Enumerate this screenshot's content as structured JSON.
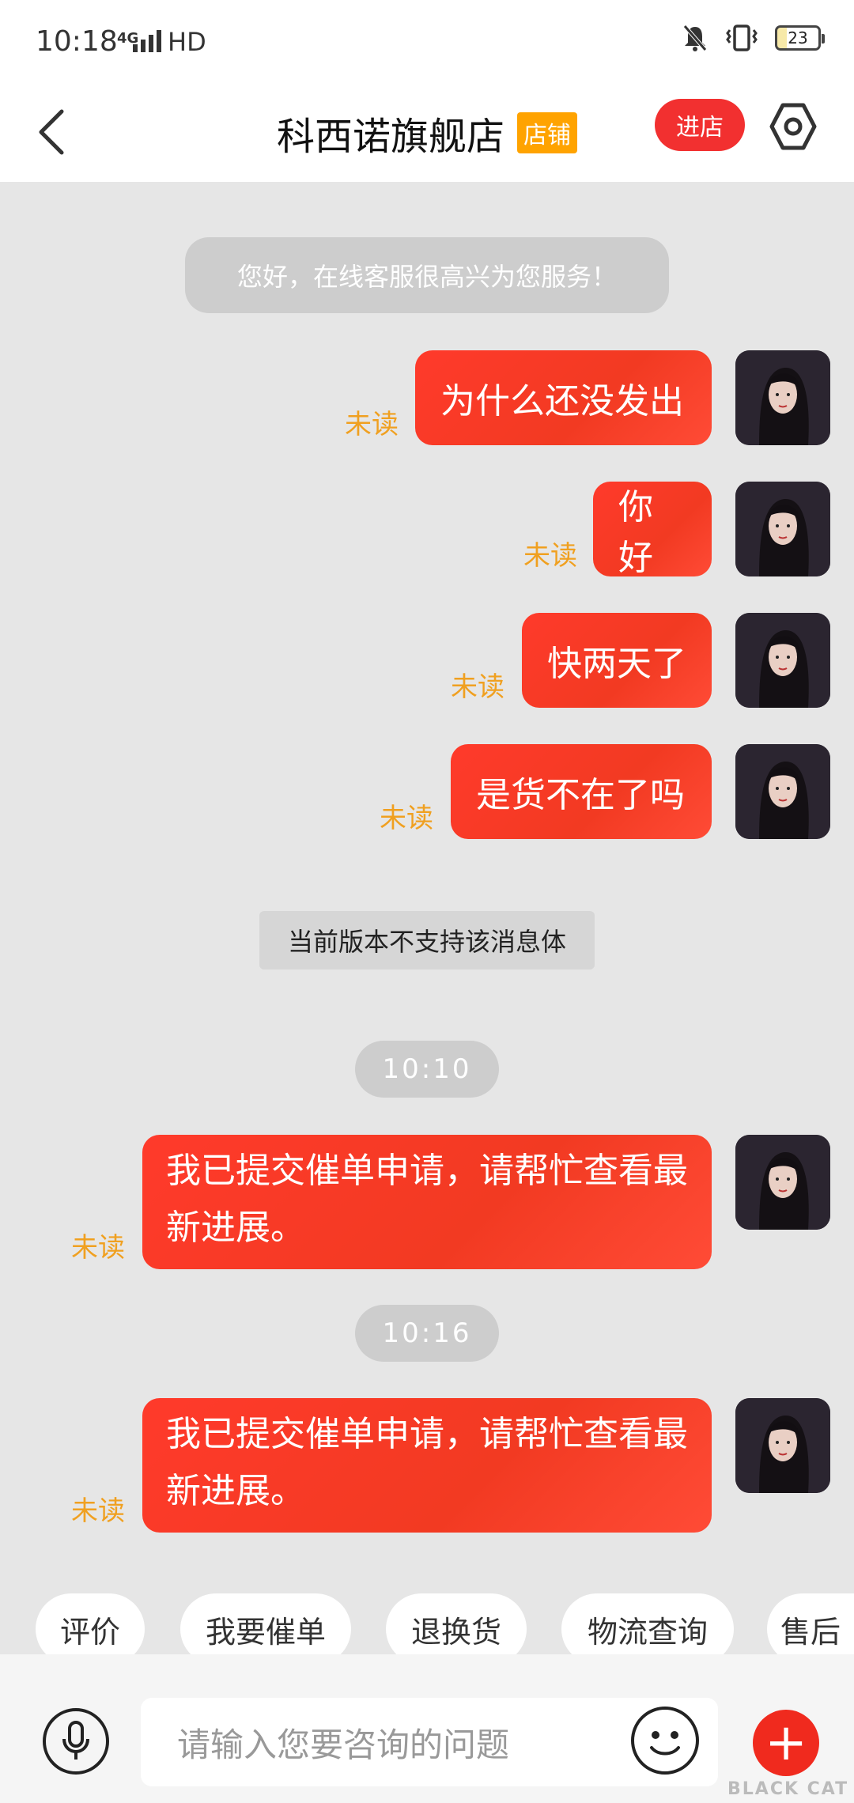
{
  "status_bar": {
    "time": "10:18",
    "network": "4G",
    "hd": "HD",
    "battery": "23"
  },
  "header": {
    "title": "科西诺旗舰店",
    "badge": "店铺",
    "enter_label": "进店"
  },
  "chat": {
    "welcome": "您好，在线客服很高兴为您服务！",
    "messages": [
      {
        "text": "为什么还没发出",
        "status": "未读"
      },
      {
        "text": "你好",
        "status": "未读"
      },
      {
        "text": "快两天了",
        "status": "未读"
      },
      {
        "text": "是货不在了吗",
        "status": "未读"
      },
      {
        "text": "我已提交催单申请，请帮忙查看最新进展。",
        "status": "未读"
      },
      {
        "text": "我已提交催单申请，请帮忙查看最新进展。",
        "status": "未读"
      }
    ],
    "notice": "当前版本不支持该消息体",
    "times": [
      "10:10",
      "10:16"
    ]
  },
  "quick_replies": [
    "评价",
    "我要催单",
    "退换货",
    "物流查询",
    "售后"
  ],
  "input": {
    "placeholder": "请输入您要咨询的问题"
  },
  "watermark": "BLACK CAT",
  "colors": {
    "accent": "#f23030",
    "unread": "#f0a020",
    "badge": "#ffa300"
  }
}
